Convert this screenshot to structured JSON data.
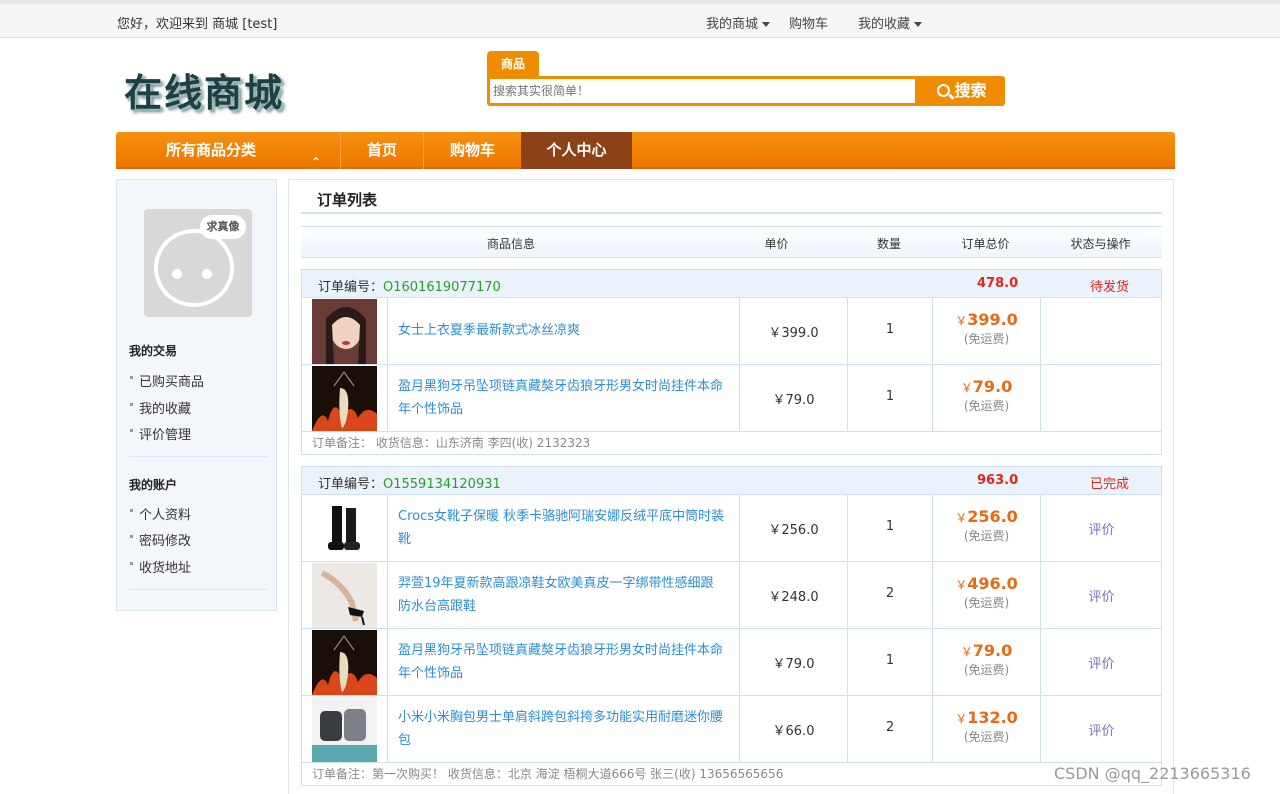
{
  "topbar": {
    "welcome": "您好，欢迎来到 商城  [test]",
    "my_mall": "我的商城",
    "cart": "购物车",
    "favorites": "我的收藏"
  },
  "logo": "在线商城",
  "search": {
    "tab": "商品",
    "placeholder": "搜索其实很简单！",
    "button": "搜索"
  },
  "mainnav": {
    "category": "所有商品分类",
    "items": [
      "首页",
      "购物车",
      "个人中心"
    ]
  },
  "sidebar": {
    "avatar_text": "求真像",
    "trade_title": "我的交易",
    "trade_items": [
      "已购买商品",
      "我的收藏",
      "评价管理"
    ],
    "account_title": "我的账户",
    "account_items": [
      "个人资料",
      "密码修改",
      "收货地址"
    ]
  },
  "content": {
    "title": "订单列表",
    "headers": [
      "商品信息",
      "单价",
      "数量",
      "订单总价",
      "状态与操作"
    ],
    "order_label": "订单编号：",
    "currency": "￥",
    "free_shipping": "(免运费)",
    "orders": [
      {
        "number": "O1601619077170",
        "total": "478.0",
        "status": "待发货",
        "items": [
          {
            "name": "女士上衣夏季最新款式冰丝凉爽",
            "price": "￥399.0",
            "qty": "1",
            "subtotal": "399.0",
            "action": ""
          },
          {
            "name": "盈月黑狗牙吊坠项链真藏獒牙齿狼牙形男女时尚挂件本命年个性饰品",
            "price": "￥79.0",
            "qty": "1",
            "subtotal": "79.0",
            "action": ""
          }
        ],
        "note": "订单备注：   收货信息：山东济南 李四(收) 2132323"
      },
      {
        "number": "O1559134120931",
        "total": "963.0",
        "status": "已完成",
        "items": [
          {
            "name": "Crocs女靴子保暖 秋季卡骆驰阿瑞安娜反绒平底中筒时装靴",
            "price": "￥256.0",
            "qty": "1",
            "subtotal": "256.0",
            "action": "评价"
          },
          {
            "name": "羿萱19年夏新款高跟凉鞋女欧美真皮一字绑带性感细跟防水台高跟鞋",
            "price": "￥248.0",
            "qty": "2",
            "subtotal": "496.0",
            "action": "评价"
          },
          {
            "name": "盈月黑狗牙吊坠项链真藏獒牙齿狼牙形男女时尚挂件本命年个性饰品",
            "price": "￥79.0",
            "qty": "1",
            "subtotal": "79.0",
            "action": "评价"
          },
          {
            "name": "小米小米胸包男士单肩斜跨包斜挎多功能实用耐磨迷你腰包",
            "price": "￥66.0",
            "qty": "2",
            "subtotal": "132.0",
            "action": "评价"
          }
        ],
        "note": "订单备注：第一次购买！   收货信息：北京 海淀 梧桐大道666号 张三(收) 13656565656"
      }
    ]
  },
  "watermark": "CSDN @qq_2213665316"
}
